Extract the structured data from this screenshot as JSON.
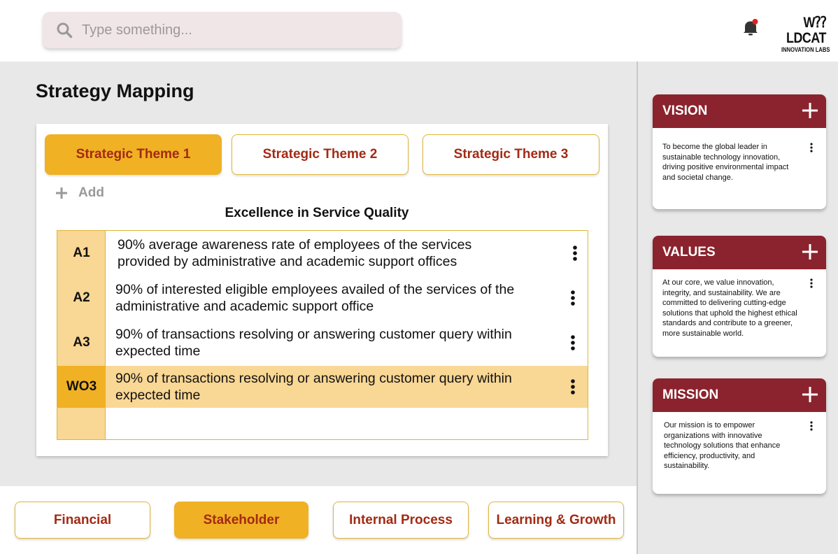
{
  "header": {
    "search_placeholder": "Type something...",
    "logo_main": "W⁇LDCAT",
    "logo_sub": "INNOVATION LABS",
    "notification_dot_color": "#e02020"
  },
  "main": {
    "page_title": "Strategy Mapping",
    "theme_tabs": [
      {
        "label": "Strategic Theme 1",
        "active": true
      },
      {
        "label": "Strategic Theme 2",
        "active": false
      },
      {
        "label": "Strategic Theme 3",
        "active": false
      }
    ],
    "add_label": "Add",
    "section_title": "Excellence in Service Quality",
    "rows": [
      {
        "code": "A1",
        "description": "90% average awareness rate of employees of the services provided by administrative and academic support offices",
        "highlight": false
      },
      {
        "code": "A2",
        "description": "90% of interested eligible employees availed of the services of the administrative and academic support office",
        "highlight": false
      },
      {
        "code": "A3",
        "description": "90% of transactions resolving or answering customer query within expected time",
        "highlight": false
      },
      {
        "code": "WO3",
        "description": "90% of transactions resolving or answering customer query within expected time",
        "highlight": true
      }
    ]
  },
  "perspectives": [
    {
      "label": "Financial",
      "active": false
    },
    {
      "label": "Stakeholder",
      "active": true
    },
    {
      "label": "Internal Process",
      "active": false
    },
    {
      "label": "Learning & Growth",
      "active": false
    }
  ],
  "right_panel": {
    "cards": [
      {
        "title": "VISION",
        "text": "To become the global leader in sustainable technology innovation, driving positive environmental impact and societal change."
      },
      {
        "title": "VALUES",
        "text": "At our core, we value innovation, integrity, and sustainability. We are committed to delivering cutting-edge solutions that uphold the highest ethical standards and contribute to a greener, more sustainable world."
      },
      {
        "title": "MISSION",
        "text": "Our mission is to empower organizations with innovative technology solutions that enhance efficiency, productivity, and sustainability."
      }
    ]
  },
  "colors": {
    "accent": "#f0b124",
    "accent_light": "#f9d794",
    "brand_red": "#8a232d",
    "tab_text": "#a32a14"
  }
}
